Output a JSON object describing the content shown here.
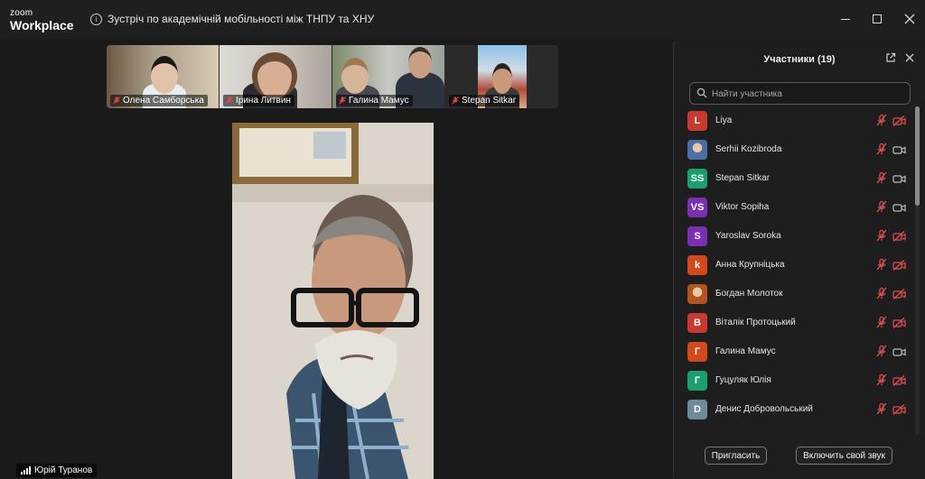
{
  "app": {
    "logo_line1": "zoom",
    "logo_line2": "Workplace"
  },
  "meeting": {
    "title": "Зустріч по академічній мобільності між ТНПУ та ХНУ"
  },
  "thumbnails": [
    {
      "name": "Олена Самборська"
    },
    {
      "name": "Ірина Литвин"
    },
    {
      "name": "Галина Мамус"
    },
    {
      "name": "Stepan Sitkar"
    }
  ],
  "active_speaker": {
    "name": "Юрій Туранов"
  },
  "panel": {
    "title": "Участники (19)",
    "search_placeholder": "Найти участника",
    "participants": [
      {
        "initials": "L",
        "name": "Liya",
        "color": "#c8392f",
        "mic_muted": true,
        "cam_off": true,
        "photo": false
      },
      {
        "initials": "",
        "name": "Serhii Kozibroda",
        "color": "#4a6fa5",
        "mic_muted": true,
        "cam_off": false,
        "photo": true
      },
      {
        "initials": "SS",
        "name": "Stepan Sitkar",
        "color": "#1aa06e",
        "mic_muted": true,
        "cam_off": false,
        "photo": false
      },
      {
        "initials": "VS",
        "name": "Viktor Sopiha",
        "color": "#7b2fb5",
        "mic_muted": true,
        "cam_off": false,
        "photo": false
      },
      {
        "initials": "S",
        "name": "Yaroslav Soroka",
        "color": "#7b2fb5",
        "mic_muted": true,
        "cam_off": true,
        "photo": false
      },
      {
        "initials": "k",
        "name": "Анна Крупніцька",
        "color": "#d4491b",
        "mic_muted": true,
        "cam_off": true,
        "photo": false
      },
      {
        "initials": "",
        "name": "Богдан Молоток",
        "color": "#b3541e",
        "mic_muted": true,
        "cam_off": true,
        "photo": true
      },
      {
        "initials": "В",
        "name": "Віталік Протоцький",
        "color": "#c8392f",
        "mic_muted": true,
        "cam_off": true,
        "photo": false
      },
      {
        "initials": "Г",
        "name": "Галина Мамус",
        "color": "#d4491b",
        "mic_muted": true,
        "cam_off": false,
        "photo": false
      },
      {
        "initials": "Г",
        "name": "Гуцуляк Юлія",
        "color": "#1aa06e",
        "mic_muted": true,
        "cam_off": true,
        "photo": false
      },
      {
        "initials": "D",
        "name": "Денис Добровольський",
        "color": "#6f8a9a",
        "mic_muted": true,
        "cam_off": true,
        "photo": false
      }
    ],
    "invite_label": "Пригласить",
    "unmute_label": "Включить свой звук"
  }
}
